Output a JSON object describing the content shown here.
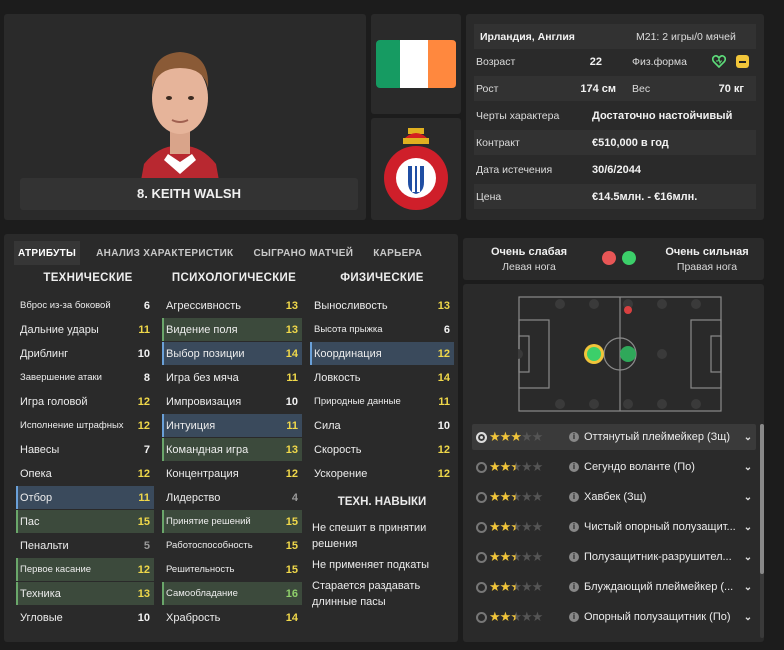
{
  "player": {
    "name": "8. KEITH WALSH",
    "flag_colors": [
      "#169b62",
      "#ffffff",
      "#ff883e"
    ],
    "club_crest": "rcd-espanyol-crest",
    "crest_text": "RCD ESPANYOL DE BARCELONA"
  },
  "info": {
    "nationality": "Ирландия, Англия",
    "u21": "M21: 2 игры/0 мячей",
    "age_label": "Возраст",
    "age": "22",
    "fitness_label": "Физ.форма",
    "height_label": "Рост",
    "height": "174 см",
    "weight_label": "Вес",
    "weight": "70 кг",
    "personality_label": "Черты характера",
    "personality": "Достаточно настойчивый",
    "contract_label": "Контракт",
    "contract": "€510,000 в год",
    "expiry_label": "Дата истечения",
    "expiry": "30/6/2044",
    "value_label": "Цена",
    "value": "€14.5млн. - €16млн."
  },
  "tabs": [
    "АТРИБУТЫ",
    "АНАЛИЗ ХАРАКТЕРИСТИК",
    "СЫГРАНО МАТЧЕЙ",
    "КАРЬЕРА"
  ],
  "columns": {
    "technical": "ТЕХНИЧЕСКИЕ",
    "mental": "ПСИХОЛОГИЧЕСКИЕ",
    "physical": "ФИЗИЧЕСКИЕ"
  },
  "technical": [
    {
      "name": "Вброс из-за боковой",
      "value": "6",
      "color": "w",
      "hl": "",
      "small": true
    },
    {
      "name": "Дальние удары",
      "value": "11",
      "color": "y",
      "hl": "",
      "small": false
    },
    {
      "name": "Дриблинг",
      "value": "10",
      "color": "w",
      "hl": "",
      "small": false
    },
    {
      "name": "Завершение атаки",
      "value": "8",
      "color": "w",
      "hl": "",
      "small": true
    },
    {
      "name": "Игра головой",
      "value": "12",
      "color": "y",
      "hl": "",
      "small": false
    },
    {
      "name": "Исполнение штрафных",
      "value": "12",
      "color": "y",
      "hl": "",
      "small": true
    },
    {
      "name": "Навесы",
      "value": "7",
      "color": "w",
      "hl": "",
      "small": false
    },
    {
      "name": "Опека",
      "value": "12",
      "color": "y",
      "hl": "",
      "small": false
    },
    {
      "name": "Отбор",
      "value": "11",
      "color": "y",
      "hl": "blue",
      "small": false
    },
    {
      "name": "Пас",
      "value": "15",
      "color": "y",
      "hl": "green",
      "small": false
    },
    {
      "name": "Пенальти",
      "value": "5",
      "color": "d",
      "hl": "",
      "small": false
    },
    {
      "name": "Первое касание",
      "value": "12",
      "color": "y",
      "hl": "green",
      "small": true
    },
    {
      "name": "Техника",
      "value": "13",
      "color": "y",
      "hl": "green",
      "small": false
    },
    {
      "name": "Угловые",
      "value": "10",
      "color": "w",
      "hl": "",
      "small": false
    }
  ],
  "mental": [
    {
      "name": "Агрессивность",
      "value": "13",
      "color": "y",
      "hl": "",
      "small": false
    },
    {
      "name": "Видение поля",
      "value": "13",
      "color": "y",
      "hl": "green",
      "small": false
    },
    {
      "name": "Выбор позиции",
      "value": "14",
      "color": "y",
      "hl": "blue",
      "small": false
    },
    {
      "name": "Игра без мяча",
      "value": "11",
      "color": "y",
      "hl": "",
      "small": false
    },
    {
      "name": "Импровизация",
      "value": "10",
      "color": "w",
      "hl": "",
      "small": false
    },
    {
      "name": "Интуиция",
      "value": "11",
      "color": "y",
      "hl": "blue",
      "small": false
    },
    {
      "name": "Командная игра",
      "value": "13",
      "color": "y",
      "hl": "green",
      "small": false
    },
    {
      "name": "Концентрация",
      "value": "12",
      "color": "y",
      "hl": "",
      "small": false
    },
    {
      "name": "Лидерство",
      "value": "4",
      "color": "d",
      "hl": "",
      "small": false
    },
    {
      "name": "Принятие решений",
      "value": "15",
      "color": "y",
      "hl": "green",
      "small": true
    },
    {
      "name": "Работоспособность",
      "value": "15",
      "color": "y",
      "hl": "",
      "small": true
    },
    {
      "name": "Решительность",
      "value": "15",
      "color": "y",
      "hl": "",
      "small": true
    },
    {
      "name": "Самообладание",
      "value": "16",
      "color": "g",
      "hl": "green",
      "small": true
    },
    {
      "name": "Храбрость",
      "value": "14",
      "color": "y",
      "hl": "",
      "small": false
    }
  ],
  "physical": [
    {
      "name": "Выносливость",
      "value": "13",
      "color": "y",
      "hl": "",
      "small": false
    },
    {
      "name": "Высота прыжка",
      "value": "6",
      "color": "w",
      "hl": "",
      "small": true
    },
    {
      "name": "Координация",
      "value": "12",
      "color": "y",
      "hl": "blue",
      "small": false
    },
    {
      "name": "Ловкость",
      "value": "14",
      "color": "y",
      "hl": "",
      "small": false
    },
    {
      "name": "Природные данные",
      "value": "11",
      "color": "y",
      "hl": "",
      "small": true
    },
    {
      "name": "Сила",
      "value": "10",
      "color": "w",
      "hl": "",
      "small": false
    },
    {
      "name": "Скорость",
      "value": "12",
      "color": "y",
      "hl": "",
      "small": false
    },
    {
      "name": "Ускорение",
      "value": "12",
      "color": "y",
      "hl": "",
      "small": false
    }
  ],
  "traits_header": "ТЕХН. НАВЫКИ",
  "traits": [
    "Не спешит в принятии решения",
    "Не применяет подкаты",
    "Старается раздавать длинные пасы"
  ],
  "feet": {
    "left_rating": "Очень слабая",
    "left_label": "Левая нога",
    "right_rating": "Очень сильная",
    "right_label": "Правая нога"
  },
  "roles": [
    {
      "name": "Оттянутый плеймейкер (Зщ)",
      "stars": 3,
      "selected": true
    },
    {
      "name": "Сегундо воланте (По)",
      "stars": 2.5,
      "selected": false
    },
    {
      "name": "Хавбек (Зщ)",
      "stars": 2.5,
      "selected": false
    },
    {
      "name": "Чистый опорный полузащит...",
      "stars": 2.5,
      "selected": false
    },
    {
      "name": "Полузащитник-разрушител...",
      "stars": 2.5,
      "selected": false
    },
    {
      "name": "Блуждающий плеймейкер (...",
      "stars": 2.5,
      "selected": false
    },
    {
      "name": "Опорный полузащитник (По)",
      "stars": 2.5,
      "selected": false
    }
  ]
}
